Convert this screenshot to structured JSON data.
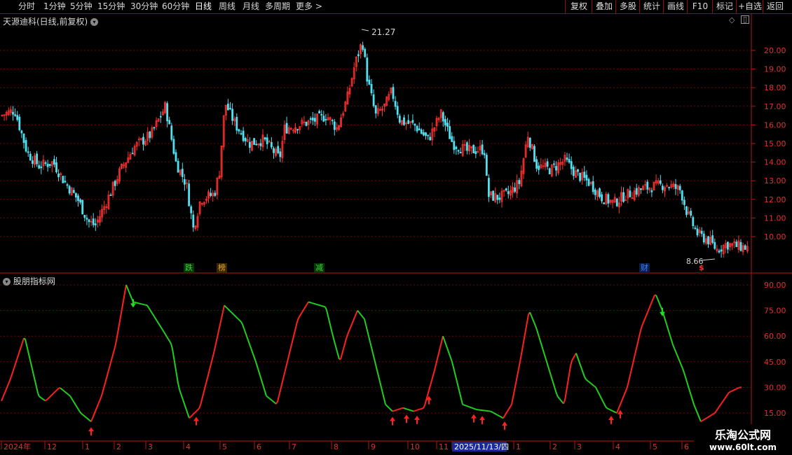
{
  "topbar": {
    "tabs": [
      "分时",
      "1分钟",
      "5分钟",
      "15分钟",
      "30分钟",
      "60分钟",
      "日线",
      "周线",
      "月线",
      "多周期",
      "更多 >"
    ],
    "active_tab": "日线",
    "right_buttons": [
      "复权",
      "叠加",
      "多股",
      "统计",
      "画线",
      "F10",
      "标记",
      "+自选",
      "返回"
    ]
  },
  "main_panel": {
    "title": "天源迪科(日线,前复权)",
    "high_label": "21.27",
    "low_label": "8.66",
    "y_axis": [
      "20.00",
      "19.00",
      "18.00",
      "17.00",
      "16.00",
      "15.00",
      "14.00",
      "13.00",
      "12.00",
      "11.00",
      "10.00"
    ],
    "event_tags": [
      {
        "text": "跌",
        "color": "#40d040"
      },
      {
        "text": "榜",
        "color": "#e0a030"
      },
      {
        "text": "减",
        "color": "#40d040"
      },
      {
        "text": "财",
        "color": "#4080ff"
      },
      {
        "text": "$",
        "color": "#ff3030"
      }
    ]
  },
  "indicator_panel": {
    "title": "股朋指标网",
    "y_axis": [
      "90.00",
      "75.00",
      "60.00",
      "45.00",
      "30.00",
      "15.00"
    ]
  },
  "x_axis": {
    "labels": [
      "2024年",
      "12",
      "1",
      "2",
      "3",
      "4",
      "5",
      "6",
      "7",
      "8",
      "9",
      "10",
      "11",
      "2025/11/13/四",
      "1",
      "2",
      "3",
      "4",
      "5",
      "6"
    ],
    "highlight": "2025/11/13/四"
  },
  "watermark": {
    "line1": "乐淘公式网",
    "line2": "www.60lt.com"
  },
  "colors": {
    "up": "#ff3030",
    "down": "#50e0f0",
    "ind_up": "#ff2020",
    "ind_down": "#20d020",
    "grid": "#7a0000"
  }
}
